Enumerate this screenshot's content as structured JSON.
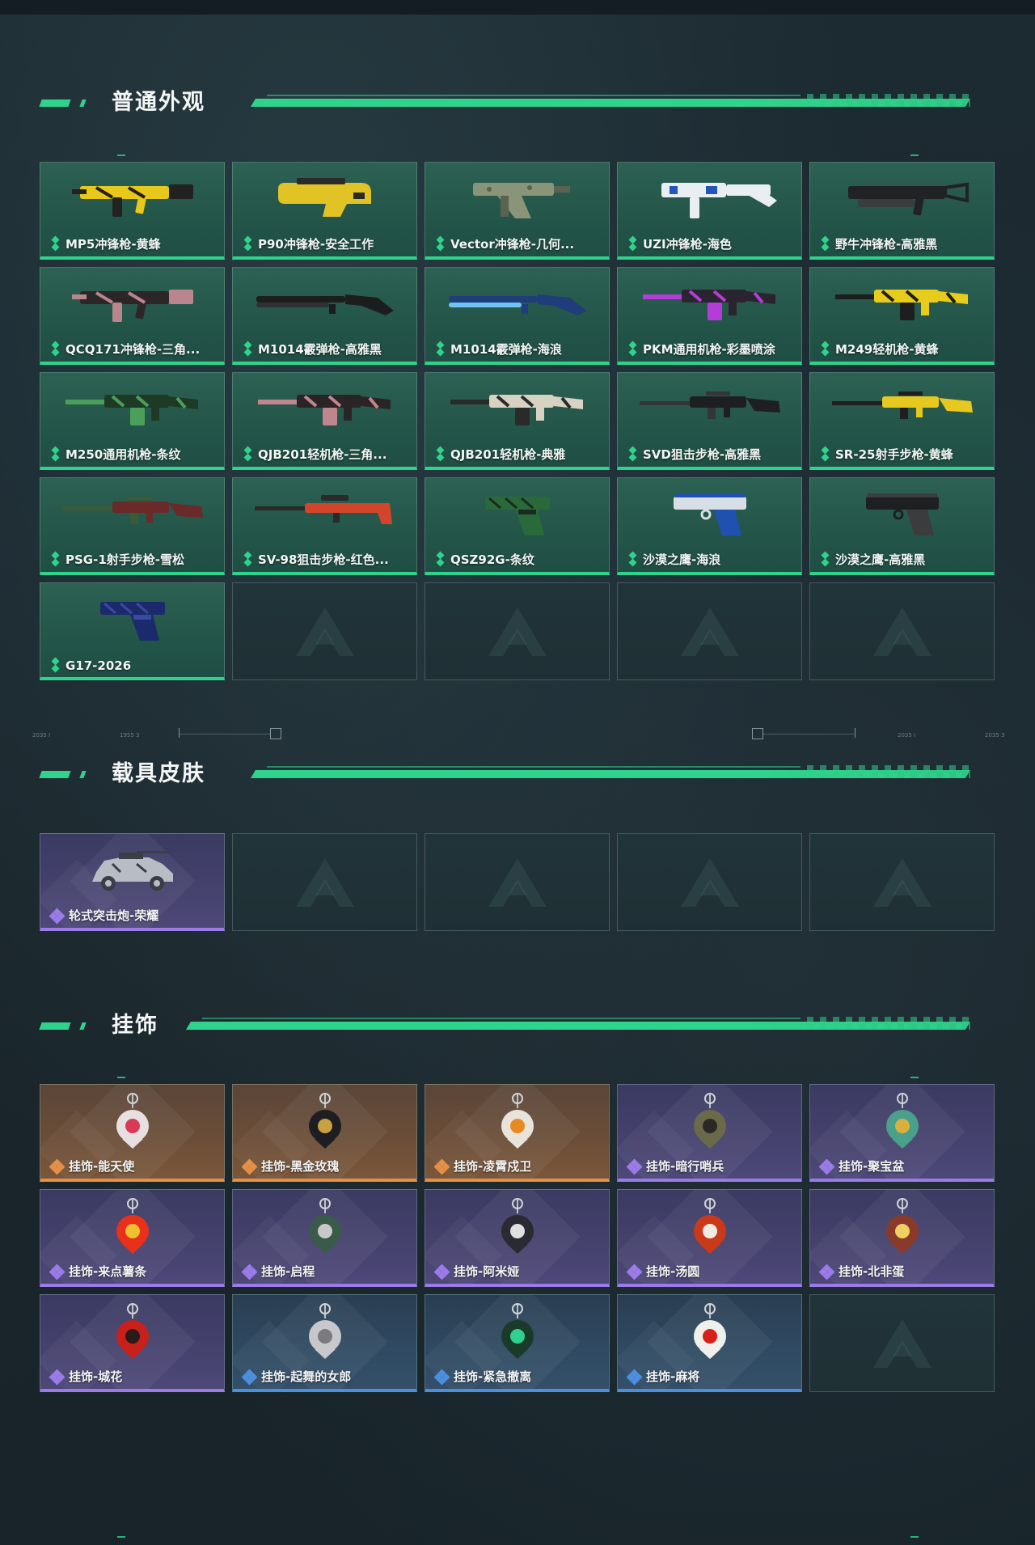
{
  "sections": [
    {
      "title": "普通外观",
      "items": [
        {
          "label": "MP5冲锋枪-黄蜂",
          "rarity": "green",
          "art": "smg",
          "color": "#e8c81a",
          "accent": "#222222"
        },
        {
          "label": "P90冲锋枪-安全工作",
          "rarity": "green",
          "art": "p90",
          "color": "#e2c325",
          "accent": "#2a2a2a"
        },
        {
          "label": "Vector冲锋枪-几何...",
          "rarity": "green",
          "art": "vector",
          "color": "#8a9478",
          "accent": "#5a6350"
        },
        {
          "label": "UZI冲锋枪-海色",
          "rarity": "green",
          "art": "uzi",
          "color": "#e9eef2",
          "accent": "#2356b8"
        },
        {
          "label": "野牛冲锋枪-高雅黑",
          "rarity": "green",
          "art": "smg2",
          "color": "#202224",
          "accent": "#3a3c3e"
        },
        {
          "label": "QCQ171冲锋枪-三角...",
          "rarity": "green",
          "art": "smg",
          "color": "#2c2628",
          "accent": "#b8868c"
        },
        {
          "label": "M1014霰弹枪-高雅黑",
          "rarity": "green",
          "art": "shotgun",
          "color": "#1c1d1f",
          "accent": "#2e3032"
        },
        {
          "label": "M1014霰弹枪-海浪",
          "rarity": "green",
          "art": "shotgun",
          "color": "#1f3d7a",
          "accent": "#6fc5f0"
        },
        {
          "label": "PKM通用机枪-彩墨喷涂",
          "rarity": "green",
          "art": "mg",
          "color": "#2a2430",
          "accent": "#b43cd8"
        },
        {
          "label": "M249轻机枪-黄蜂",
          "rarity": "green",
          "art": "mg",
          "color": "#e8cc1c",
          "accent": "#1e1e1e"
        },
        {
          "label": "M250通用机枪-条纹",
          "rarity": "green",
          "art": "mg",
          "color": "#1f3a24",
          "accent": "#4aa05a"
        },
        {
          "label": "QJB201轻机枪-三角...",
          "rarity": "green",
          "art": "mg",
          "color": "#2a2427",
          "accent": "#c0868e"
        },
        {
          "label": "QJB201轻机枪-典雅",
          "rarity": "green",
          "art": "mg",
          "color": "#d8d2c2",
          "accent": "#2a2a2a"
        },
        {
          "label": "SVD狙击步枪-高雅黑",
          "rarity": "green",
          "art": "rifle",
          "color": "#1e1f21",
          "accent": "#333537"
        },
        {
          "label": "SR-25射手步枪-黄蜂",
          "rarity": "green",
          "art": "rifle",
          "color": "#e6c81e",
          "accent": "#1e1e1e"
        },
        {
          "label": "PSG-1射手步枪-雪松",
          "rarity": "green",
          "art": "rifle",
          "color": "#6a2a2a",
          "accent": "#3a5a3a"
        },
        {
          "label": "SV-98狙击步枪-红色...",
          "rarity": "green",
          "art": "sniper",
          "color": "#d2452a",
          "accent": "#2a2a2a"
        },
        {
          "label": "QSZ92G-条纹",
          "rarity": "green",
          "art": "pistol",
          "color": "#2a6a3a",
          "accent": "#1a2a1e"
        },
        {
          "label": "沙漠之鹰-海浪",
          "rarity": "green",
          "art": "deagle",
          "color": "#d8dee6",
          "accent": "#2050b0"
        },
        {
          "label": "沙漠之鹰-高雅黑",
          "rarity": "green",
          "art": "deagle",
          "color": "#1e1f21",
          "accent": "#3a3c3e"
        },
        {
          "label": "G17-2026",
          "rarity": "green",
          "art": "pistol",
          "color": "#1a2a6a",
          "accent": "#3a4aa0"
        },
        {
          "label": "",
          "rarity": "empty"
        },
        {
          "label": "",
          "rarity": "empty"
        },
        {
          "label": "",
          "rarity": "empty"
        },
        {
          "label": "",
          "rarity": "empty"
        }
      ]
    },
    {
      "title": "载具皮肤",
      "items": [
        {
          "label": "轮式突击炮-荣耀",
          "rarity": "purple",
          "art": "vehicle",
          "color": "#b8bcc4",
          "accent": "#3a3e46"
        },
        {
          "label": "",
          "rarity": "empty"
        },
        {
          "label": "",
          "rarity": "empty"
        },
        {
          "label": "",
          "rarity": "empty"
        },
        {
          "label": "",
          "rarity": "empty"
        }
      ]
    },
    {
      "title": "挂饰",
      "items": [
        {
          "label": "挂饰-能天使",
          "rarity": "orange",
          "art": "charm",
          "color": "#e8e0e0",
          "accent": "#d83a5a"
        },
        {
          "label": "挂饰-黑金玫瑰",
          "rarity": "orange",
          "art": "charm",
          "color": "#1e1e22",
          "accent": "#c8a040"
        },
        {
          "label": "挂饰-凌霄戍卫",
          "rarity": "orange",
          "art": "charm",
          "color": "#e8e4dc",
          "accent": "#e88a20"
        },
        {
          "label": "挂饰-暗行哨兵",
          "rarity": "purple",
          "art": "charm",
          "color": "#6a6a4a",
          "accent": "#2a2a22"
        },
        {
          "label": "挂饰-聚宝盆",
          "rarity": "purple",
          "art": "charm",
          "color": "#4aa08a",
          "accent": "#d8b040"
        },
        {
          "label": "挂饰-来点薯条",
          "rarity": "purple",
          "art": "charm",
          "color": "#e8301a",
          "accent": "#f0c030"
        },
        {
          "label": "挂饰-启程",
          "rarity": "purple",
          "art": "charm",
          "color": "#3a5a4a",
          "accent": "#c8c8c8"
        },
        {
          "label": "挂饰-阿米娅",
          "rarity": "purple",
          "art": "charm",
          "color": "#2a2a32",
          "accent": "#e0e0e0"
        },
        {
          "label": "挂饰-汤圆",
          "rarity": "purple",
          "art": "charm",
          "color": "#c83a1a",
          "accent": "#f0ece4"
        },
        {
          "label": "挂饰-北非蛋",
          "rarity": "purple",
          "art": "charm",
          "color": "#8a3a2a",
          "accent": "#f0d060"
        },
        {
          "label": "挂饰-城花",
          "rarity": "purple",
          "art": "charm",
          "color": "#c8201a",
          "accent": "#2a1a1a"
        },
        {
          "label": "挂饰-起舞的女郎",
          "rarity": "blue",
          "art": "charm",
          "color": "#c8c8cc",
          "accent": "#7a7a80"
        },
        {
          "label": "挂饰-紧急撤离",
          "rarity": "blue",
          "art": "charm",
          "color": "#1a3a2a",
          "accent": "#30d090"
        },
        {
          "label": "挂饰-麻将",
          "rarity": "blue",
          "art": "charm",
          "color": "#f0f0ea",
          "accent": "#d8201a"
        },
        {
          "label": "",
          "rarity": "empty"
        }
      ]
    }
  ],
  "rarity_colors": {
    "green": "#2fd48c",
    "purple": "#9a7be8",
    "orange": "#e59048",
    "blue": "#4b8fde"
  },
  "deco_labels": [
    "2035 I",
    "1955 3",
    "2035 I",
    "2035 3"
  ]
}
